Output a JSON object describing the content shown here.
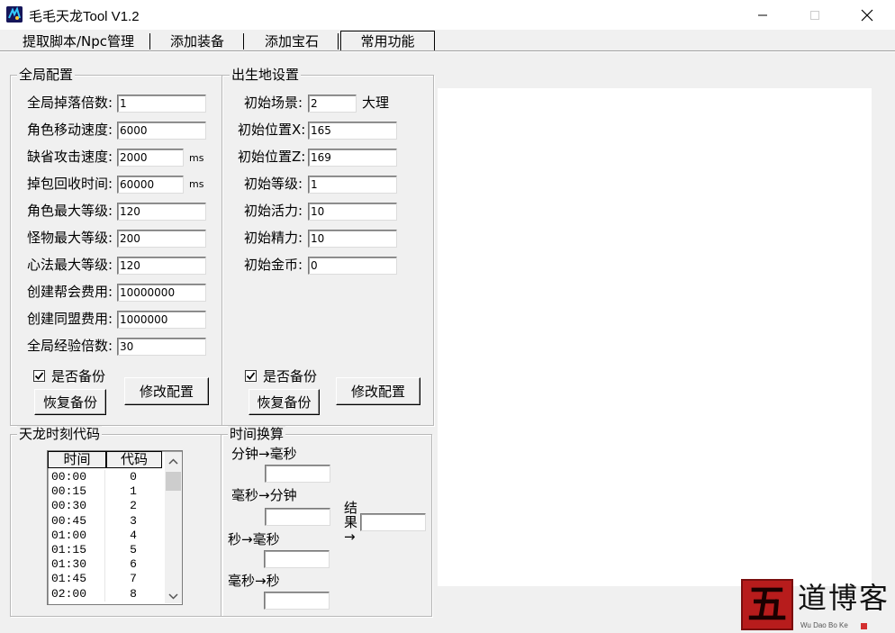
{
  "window": {
    "title": "毛毛天龙Tool V1.2"
  },
  "tabs": [
    {
      "label": "提取脚本/Npc管理"
    },
    {
      "label": "添加装备"
    },
    {
      "label": "添加宝石"
    },
    {
      "label": "常用功能"
    }
  ],
  "global": {
    "legend": "全局配置",
    "fields": [
      {
        "label": "全局掉落倍数:",
        "value": "1"
      },
      {
        "label": "角色移动速度:",
        "value": "6000"
      },
      {
        "label": "缺省攻击速度:",
        "value": "2000",
        "unit": "ms"
      },
      {
        "label": "掉包回收时间:",
        "value": "60000",
        "unit": "ms"
      },
      {
        "label": "角色最大等级:",
        "value": "120"
      },
      {
        "label": "怪物最大等级:",
        "value": "200"
      },
      {
        "label": "心法最大等级:",
        "value": "120"
      },
      {
        "label": "创建帮会费用:",
        "value": "10000000"
      },
      {
        "label": "创建同盟费用:",
        "value": "1000000"
      },
      {
        "label": "全局经验倍数:",
        "value": "30"
      }
    ],
    "backup_label": "是否备份",
    "restore_button": "恢复备份",
    "modify_button": "修改配置"
  },
  "birth": {
    "legend": "出生地设置",
    "fields": [
      {
        "label": "初始场景:",
        "value": "2",
        "suffix": "大理"
      },
      {
        "label": "初始位置X:",
        "value": "165"
      },
      {
        "label": "初始位置Z:",
        "value": "169"
      },
      {
        "label": "初始等级:",
        "value": "1"
      },
      {
        "label": "初始活力:",
        "value": "10"
      },
      {
        "label": "初始精力:",
        "value": "10"
      },
      {
        "label": "初始金币:",
        "value": "0"
      }
    ],
    "backup_label": "是否备份",
    "restore_button": "恢复备份",
    "modify_button": "修改配置"
  },
  "timecode": {
    "legend": "天龙时刻代码",
    "columns": [
      "时间",
      "代码"
    ],
    "rows": [
      [
        "00:00",
        "0"
      ],
      [
        "00:15",
        "1"
      ],
      [
        "00:30",
        "2"
      ],
      [
        "00:45",
        "3"
      ],
      [
        "01:00",
        "4"
      ],
      [
        "01:15",
        "5"
      ],
      [
        "01:30",
        "6"
      ],
      [
        "01:45",
        "7"
      ],
      [
        "02:00",
        "8"
      ]
    ]
  },
  "convert": {
    "legend": "时间换算",
    "min_to_ms": "分钟→毫秒",
    "ms_to_min": "毫秒→分钟",
    "sec_to_ms": "秒→毫秒",
    "ms_to_sec": "毫秒→秒",
    "result_label": "结果→"
  },
  "watermark": {
    "glyph": "五",
    "text": "道博客",
    "sub": "Wu Dao Bo Ke"
  },
  "colors": {
    "accent": "#b71c1c",
    "window_bg": "#f0f0f0"
  }
}
